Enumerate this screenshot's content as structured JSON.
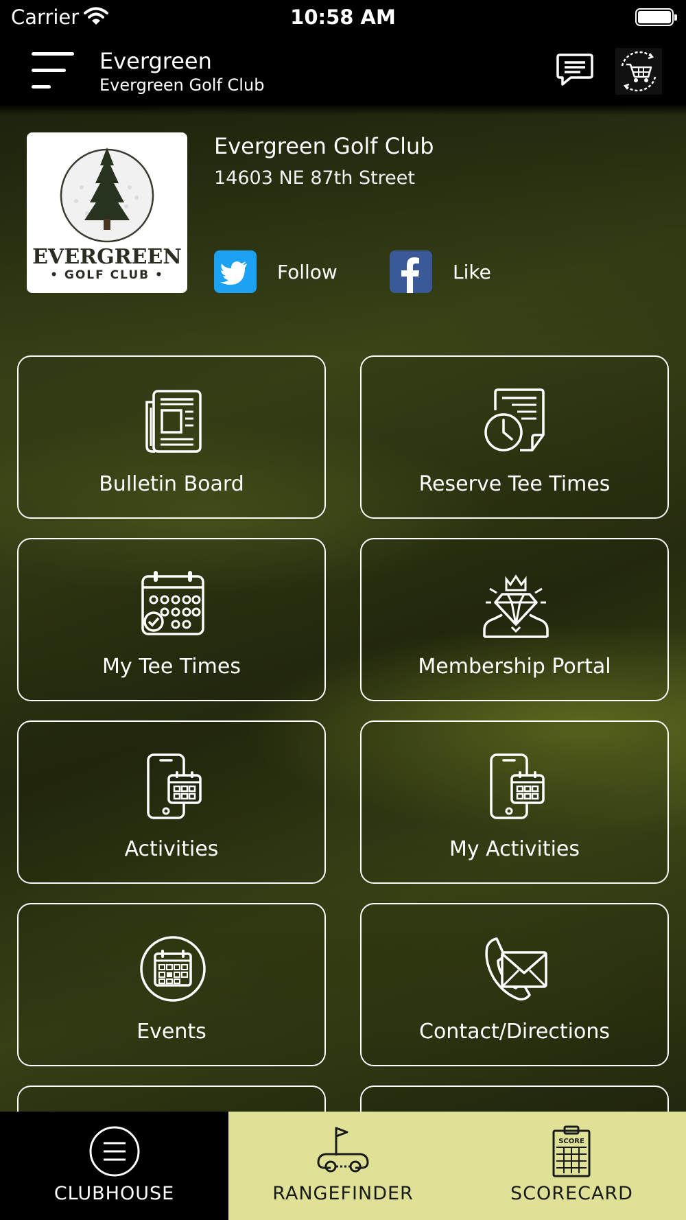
{
  "status_bar": {
    "carrier": "Carrier",
    "time": "10:58 AM"
  },
  "header": {
    "title": "Evergreen",
    "subtitle": "Evergreen Golf Club"
  },
  "club": {
    "name": "Evergreen Golf Club",
    "address": "14603 NE 87th Street",
    "logo_text": "EVERGREEN",
    "logo_subtext": "• GOLF CLUB •"
  },
  "social": {
    "twitter_label": "Follow",
    "facebook_label": "Like"
  },
  "tiles": [
    {
      "label": "Bulletin Board",
      "icon": "newspaper-icon"
    },
    {
      "label": "Reserve Tee Times",
      "icon": "document-clock-icon"
    },
    {
      "label": "My Tee Times",
      "icon": "calendar-check-icon"
    },
    {
      "label": "Membership Portal",
      "icon": "diamond-member-icon"
    },
    {
      "label": "Activities",
      "icon": "phone-calendar-icon"
    },
    {
      "label": "My Activities",
      "icon": "phone-calendar-icon"
    },
    {
      "label": "Events",
      "icon": "calendar-circle-icon"
    },
    {
      "label": "Contact/Directions",
      "icon": "phone-envelope-icon"
    }
  ],
  "tab_bar": {
    "items": [
      {
        "label": "CLUBHOUSE",
        "icon": "menu-circle-icon"
      },
      {
        "label": "RANGEFINDER",
        "icon": "golf-cart-flag-icon"
      },
      {
        "label": "SCORECARD",
        "icon": "scorecard-icon"
      }
    ],
    "scorecard_icon_text": "SCORE"
  },
  "colors": {
    "tab_active_bg": "#000000",
    "tab_inactive_bg": "#dfe196",
    "twitter": "#1da1f2",
    "facebook": "#3b5998"
  }
}
